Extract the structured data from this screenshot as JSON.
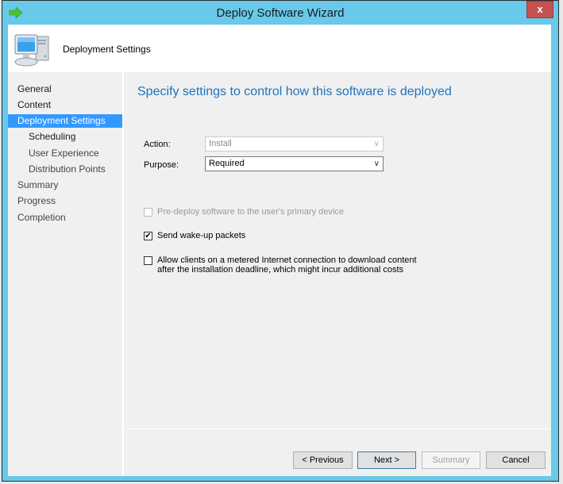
{
  "window": {
    "title": "Deploy Software Wizard",
    "close_label": "x",
    "app_icon": "green-arrow-icon"
  },
  "header": {
    "title": "Deployment Settings",
    "icon": "computer-icon"
  },
  "nav": {
    "items": [
      {
        "label": "General",
        "level": 0,
        "state": "normal"
      },
      {
        "label": "Content",
        "level": 0,
        "state": "normal"
      },
      {
        "label": "Deployment Settings",
        "level": 0,
        "state": "active"
      },
      {
        "label": "Scheduling",
        "level": 1,
        "state": "normal"
      },
      {
        "label": "User Experience",
        "level": 1,
        "state": "dim"
      },
      {
        "label": "Distribution Points",
        "level": 1,
        "state": "dim"
      },
      {
        "label": "Summary",
        "level": 0,
        "state": "dim"
      },
      {
        "label": "Progress",
        "level": 0,
        "state": "dim"
      },
      {
        "label": "Completion",
        "level": 0,
        "state": "dim"
      }
    ]
  },
  "main": {
    "heading": "Specify settings to control how this software is deployed",
    "action": {
      "label": "Action:",
      "value": "Install",
      "enabled": false
    },
    "purpose": {
      "label": "Purpose:",
      "value": "Required",
      "enabled": true
    },
    "options": [
      {
        "label": "Pre-deploy software to the user's primary device",
        "checked": false,
        "enabled": false
      },
      {
        "label": "Send wake-up packets",
        "checked": true,
        "enabled": true
      },
      {
        "label": "Allow clients on a metered Internet connection to download content after the installation deadline, which might incur additional costs",
        "checked": false,
        "enabled": true
      }
    ]
  },
  "buttons": {
    "previous": "< Previous",
    "next": "Next >",
    "summary": "Summary",
    "cancel": "Cancel"
  },
  "icons": {
    "dropdown_arrow": "∨",
    "checkmark": "✔"
  }
}
